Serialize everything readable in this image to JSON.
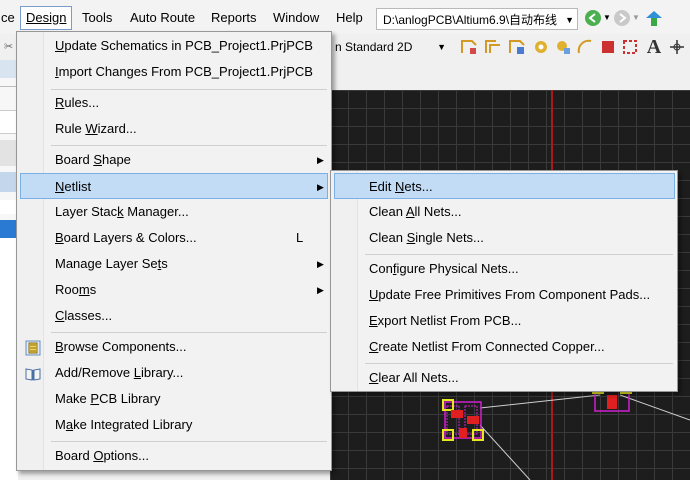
{
  "menubar": {
    "items": [
      {
        "label": "ce"
      },
      {
        "label": "Design"
      },
      {
        "label": "Tools"
      },
      {
        "label": "Auto Route"
      },
      {
        "label": "Reports"
      },
      {
        "label": "Window"
      },
      {
        "label": "Help"
      }
    ],
    "path": "D:\\anlogPCB\\Altium6.9\\自动布线"
  },
  "toolbar": {
    "view_mode": "n Standard 2D"
  },
  "design_menu": {
    "items": [
      {
        "label": "Update Schematics in PCB_Project1.PrjPCB",
        "accel": "U"
      },
      {
        "label": "Import Changes From PCB_Project1.PrjPCB",
        "accel": "I"
      },
      {
        "label": "Rules...",
        "accel": "R"
      },
      {
        "label": "Rule Wizard...",
        "accel": "W"
      },
      {
        "label": "Board Shape",
        "accel": "S"
      },
      {
        "label": "Netlist",
        "accel": "N"
      },
      {
        "label": "Layer Stack Manager...",
        "accel": "k"
      },
      {
        "label": "Board Layers & Colors...",
        "accel": "B",
        "shortcut": "L"
      },
      {
        "label": "Manage Layer Sets",
        "accel": "t"
      },
      {
        "label": "Rooms",
        "accel": "m"
      },
      {
        "label": "Classes...",
        "accel": "C"
      },
      {
        "label": "Browse Components...",
        "accel": "B"
      },
      {
        "label": "Add/Remove Library...",
        "accel": "L"
      },
      {
        "label": "Make PCB Library",
        "accel": "P"
      },
      {
        "label": "Make Integrated Library",
        "accel": "a"
      },
      {
        "label": "Board Options...",
        "accel": "O"
      }
    ]
  },
  "netlist_submenu": {
    "items": [
      {
        "label": "Edit Nets...",
        "accel": "N"
      },
      {
        "label": "Clean All Nets...",
        "accel": "A"
      },
      {
        "label": "Clean Single Nets...",
        "accel": "S"
      },
      {
        "label": "Configure Physical Nets...",
        "accel": "f"
      },
      {
        "label": "Update Free Primitives From Component Pads...",
        "accel": "U"
      },
      {
        "label": "Export Netlist From PCB...",
        "accel": "E"
      },
      {
        "label": "Create Netlist From Connected Copper...",
        "accel": "C"
      },
      {
        "label": "Clear All Nets...",
        "accel": "C"
      }
    ]
  },
  "colors": {
    "highlight": "#c3dcf5",
    "canvas_bg": "#1d1d1d",
    "board_edge": "#b01818"
  }
}
